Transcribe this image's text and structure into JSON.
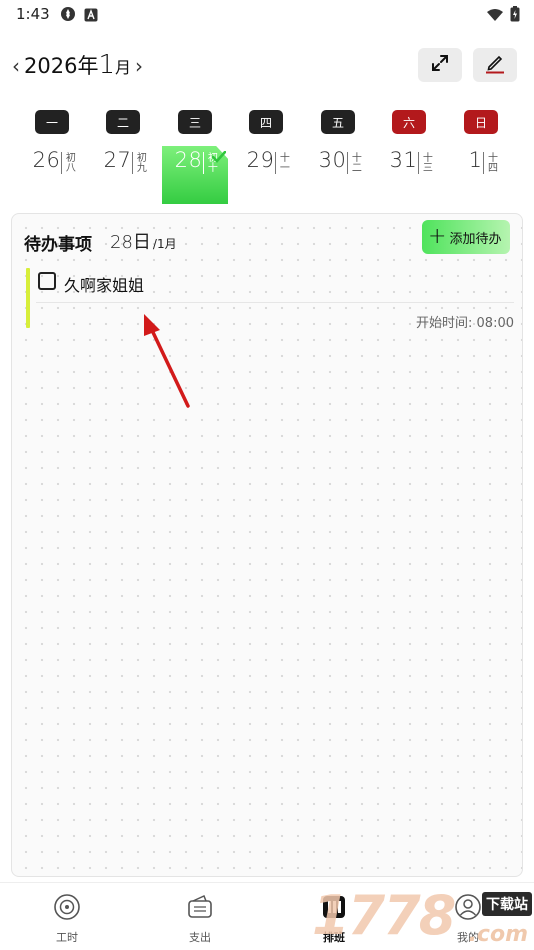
{
  "status_bar": {
    "time": "1:43",
    "left_icons": [
      "settings-gear-icon",
      "keyboard-a-icon"
    ],
    "right_icons": [
      "wifi-icon",
      "battery-icon"
    ]
  },
  "header": {
    "year_label": "2026年",
    "month_number": "1",
    "month_unit": "月",
    "prev_icon": "chevron-left-icon",
    "next_icon": "chevron-right-icon",
    "actions": [
      "expand-icon",
      "pencil-icon"
    ]
  },
  "week": {
    "days": [
      {
        "weekday": "一",
        "date": "26",
        "lunar": "初八",
        "weekend": false
      },
      {
        "weekday": "二",
        "date": "27",
        "lunar": "初九",
        "weekend": false
      },
      {
        "weekday": "三",
        "date": "28",
        "lunar": "初十",
        "weekend": false,
        "selected": true
      },
      {
        "weekday": "四",
        "date": "29",
        "lunar": "十一",
        "weekend": false
      },
      {
        "weekday": "五",
        "date": "30",
        "lunar": "十二",
        "weekend": false
      },
      {
        "weekday": "六",
        "date": "31",
        "lunar": "十三",
        "weekend": true
      },
      {
        "weekday": "日",
        "date": "1",
        "lunar": "十四",
        "weekend": true
      }
    ]
  },
  "todo": {
    "title": "待办事项",
    "date_day": "28日",
    "date_month": "/1月",
    "add_button_label": "添加待办",
    "items": [
      {
        "text": "久啊家姐姐",
        "start_time": "开始时间: 08:00",
        "checked": false,
        "accent_color": "#d7ee3a"
      }
    ]
  },
  "bottom_nav": {
    "items": [
      {
        "label": "工时",
        "icon": "clock-circle-icon"
      },
      {
        "label": "支出",
        "icon": "wallet-icon"
      },
      {
        "label": "排班",
        "icon": "schedule-icon",
        "active": true
      },
      {
        "label": "我的",
        "icon": "person-icon"
      }
    ]
  },
  "watermark": {
    "text": "1778",
    "site": "下载站",
    "domain": ".com"
  },
  "colors": {
    "selected_green": "#34cc42",
    "weekend_red": "#b3191c",
    "weekday_dark": "#222222",
    "arrow_red": "#d21a1a"
  }
}
